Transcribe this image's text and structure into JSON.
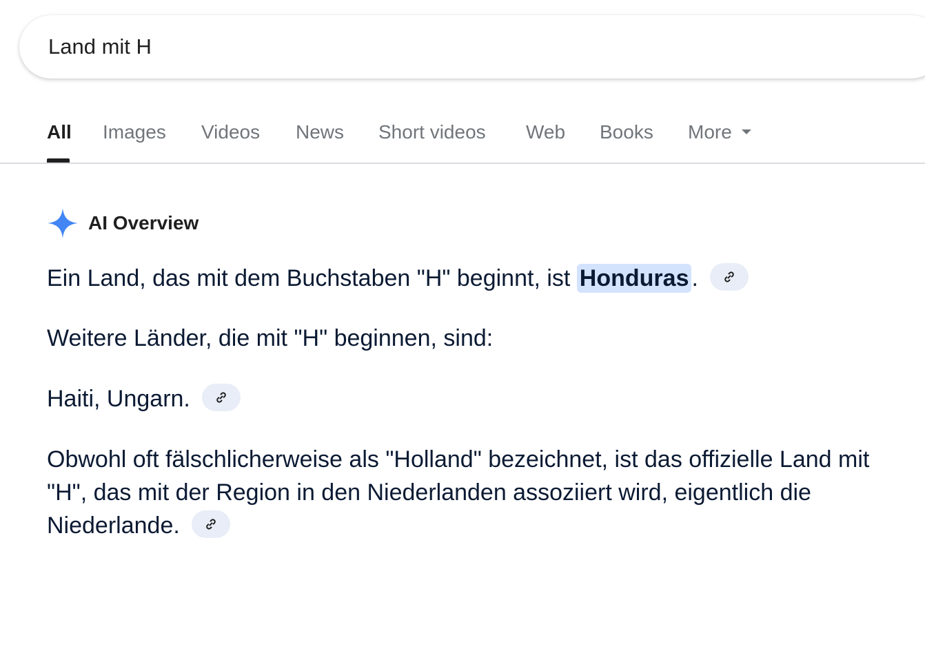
{
  "search": {
    "query": "Land mit H"
  },
  "tabs": [
    {
      "label": "All",
      "active": true
    },
    {
      "label": "Images"
    },
    {
      "label": "Videos"
    },
    {
      "label": "News"
    },
    {
      "label": "Short videos"
    },
    {
      "label": "Web"
    },
    {
      "label": "Books"
    },
    {
      "label": "More"
    }
  ],
  "ai_overview": {
    "title": "AI Overview",
    "icon": "sparkle-icon",
    "accent_color": "#4285f4",
    "p1": {
      "before": "Ein Land, das mit dem Buchstaben \"H\" beginnt, ist ",
      "highlight": "Honduras",
      "after": "."
    },
    "p2": "Weitere Länder, die mit \"H\" beginnen, sind:",
    "p3": "Haiti, Ungarn.",
    "p4": "Obwohl oft fälschlicherweise als \"Holland\" bezeichnet, ist das offizielle Land mit \"H\", das mit der Region in den Niederlanden assoziiert wird, eigentlich die Niederlande.",
    "link_icon": "link-icon"
  }
}
